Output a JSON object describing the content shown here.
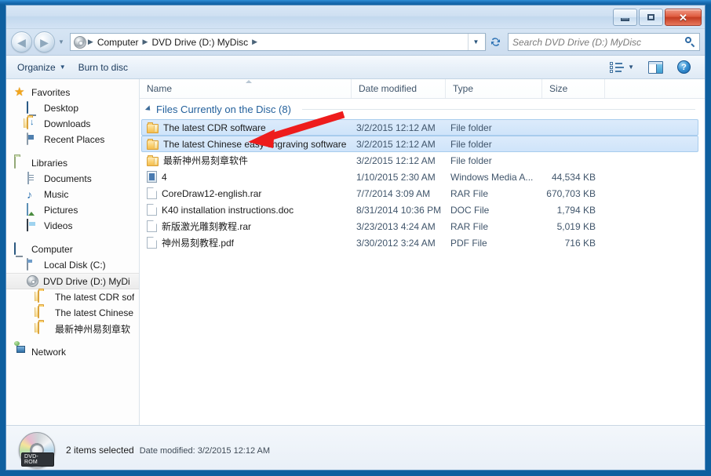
{
  "window": {
    "title": "",
    "controls": {
      "minimize": "minimize-button",
      "maximize": "maximize-button",
      "close": "✕"
    }
  },
  "address": {
    "crumbs": [
      "Computer",
      "DVD Drive (D:) MyDisc"
    ],
    "separator": "▶",
    "dropdown": "▼",
    "refresh": "refresh-icon"
  },
  "search": {
    "placeholder": "Search DVD Drive (D:) MyDisc"
  },
  "toolbar": {
    "organize": "Organize",
    "organize_caret": "▼",
    "burn": "Burn to disc",
    "view_caret": "▼",
    "help": "?"
  },
  "navpane": {
    "groups": [
      {
        "header": "Favorites",
        "items": [
          {
            "label": "Desktop"
          },
          {
            "label": "Downloads"
          },
          {
            "label": "Recent Places"
          }
        ]
      },
      {
        "header": "Libraries",
        "items": [
          {
            "label": "Documents"
          },
          {
            "label": "Music"
          },
          {
            "label": "Pictures"
          },
          {
            "label": "Videos"
          }
        ]
      },
      {
        "header": "Computer",
        "items": [
          {
            "label": "Local Disk (C:)"
          },
          {
            "label": "DVD Drive (D:) MyDi"
          },
          {
            "label": "The latest CDR sof"
          },
          {
            "label": "The latest Chinese"
          },
          {
            "label": "最新神州易刻章软"
          }
        ]
      },
      {
        "header": "Network",
        "items": []
      }
    ]
  },
  "filelist": {
    "columns": [
      {
        "label": "Name"
      },
      {
        "label": "Date modified"
      },
      {
        "label": "Type"
      },
      {
        "label": "Size"
      }
    ],
    "group_header": "Files Currently on the Disc (8)",
    "rows": [
      {
        "name": "The latest CDR software",
        "date": "3/2/2015 12:12 AM",
        "type": "File folder",
        "size": "",
        "icon": "folder-icon",
        "selected": true
      },
      {
        "name": "The latest Chinese easy engraving software",
        "date": "3/2/2015 12:12 AM",
        "type": "File folder",
        "size": "",
        "icon": "folder-icon",
        "selected": true
      },
      {
        "name": "最新神州易刻章软件",
        "date": "3/2/2015 12:12 AM",
        "type": "File folder",
        "size": "",
        "icon": "folder-icon",
        "selected": false
      },
      {
        "name": "4",
        "date": "1/10/2015 2:30 AM",
        "type": "Windows Media A...",
        "size": "44,534 KB",
        "icon": "media-file-icon",
        "selected": false
      },
      {
        "name": "CoreDraw12-english.rar",
        "date": "7/7/2014 3:09 AM",
        "type": "RAR File",
        "size": "670,703 KB",
        "icon": "document-file-icon",
        "selected": false
      },
      {
        "name": "K40 installation instructions.doc",
        "date": "8/31/2014 10:36 PM",
        "type": "DOC File",
        "size": "1,794 KB",
        "icon": "document-file-icon",
        "selected": false
      },
      {
        "name": "新版激光雕刻教程.rar",
        "date": "3/23/2013 4:24 AM",
        "type": "RAR File",
        "size": "5,019 KB",
        "icon": "document-file-icon",
        "selected": false
      },
      {
        "name": "神州易刻教程.pdf",
        "date": "3/30/2012 3:24 AM",
        "type": "PDF File",
        "size": "716 KB",
        "icon": "document-file-icon",
        "selected": false
      }
    ]
  },
  "statusbar": {
    "selection": "2 items selected",
    "date_modified": "Date modified: 3/2/2015 12:12 AM",
    "disc_label": "DVD-ROM"
  },
  "annotation": {
    "color": "#ee1c1c",
    "type": "arrow",
    "points_to": "The latest CDR software"
  }
}
